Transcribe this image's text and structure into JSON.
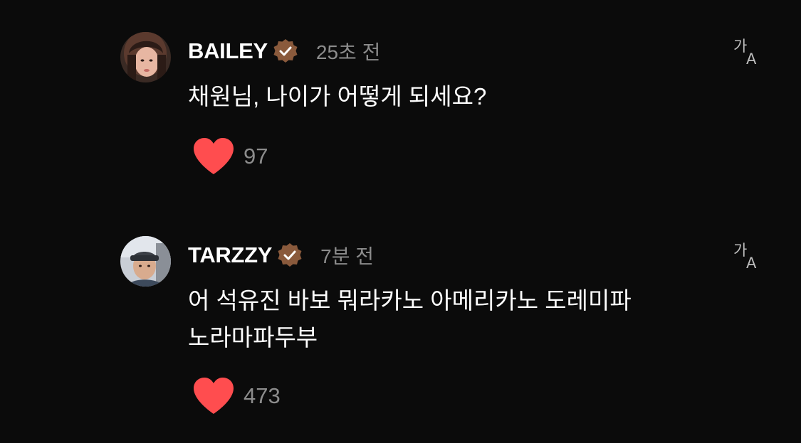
{
  "comments": [
    {
      "username": "BAILEY",
      "verified": true,
      "timestamp": "25초 전",
      "text": "채원님, 나이가 어떻게 되세요?",
      "likes": "97",
      "avatar_icon": "user-avatar-photo",
      "translate_icon": "translate-icon"
    },
    {
      "username": "TARZZY",
      "verified": true,
      "timestamp": "7분 전",
      "text_lines": [
        "어 석유진 바보 뭐라카노 아메리카노 도레미파",
        "노라마파두부"
      ],
      "likes": "473",
      "avatar_icon": "user-avatar-photo",
      "translate_icon": "translate-icon"
    }
  ],
  "colors": {
    "background": "#0b0b0b",
    "text": "#ffffff",
    "muted": "#8c8c8c",
    "verified_badge": "#8a5a3c",
    "heart": "#ff4d4f"
  }
}
